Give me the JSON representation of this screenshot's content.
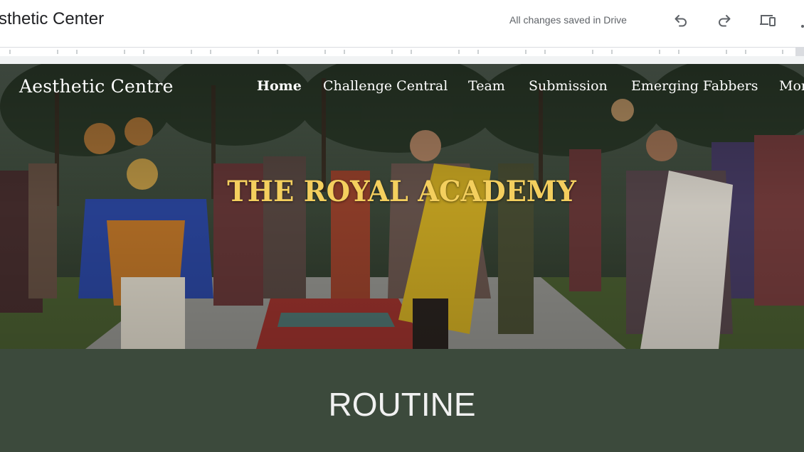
{
  "editor": {
    "doc_title": "sthetic Center",
    "save_status": "All changes saved in Drive",
    "icons": {
      "undo": "undo-icon",
      "redo": "redo-icon",
      "preview": "device-preview-icon"
    }
  },
  "site": {
    "name": "Aesthetic  Centre",
    "nav": [
      "Home",
      "Challenge Central",
      "Team",
      "Submission",
      "Emerging Fabbers",
      "Mor"
    ],
    "active_nav": "Home"
  },
  "hero": {
    "title": "THE ROYAL ACADEMY"
  },
  "section": {
    "title": "ROUTINE"
  },
  "colors": {
    "hero_title": "#f4cf5e",
    "section_bg": "#3c4a3c",
    "nav_text": "#ffffff",
    "status_text": "#5f6368"
  }
}
